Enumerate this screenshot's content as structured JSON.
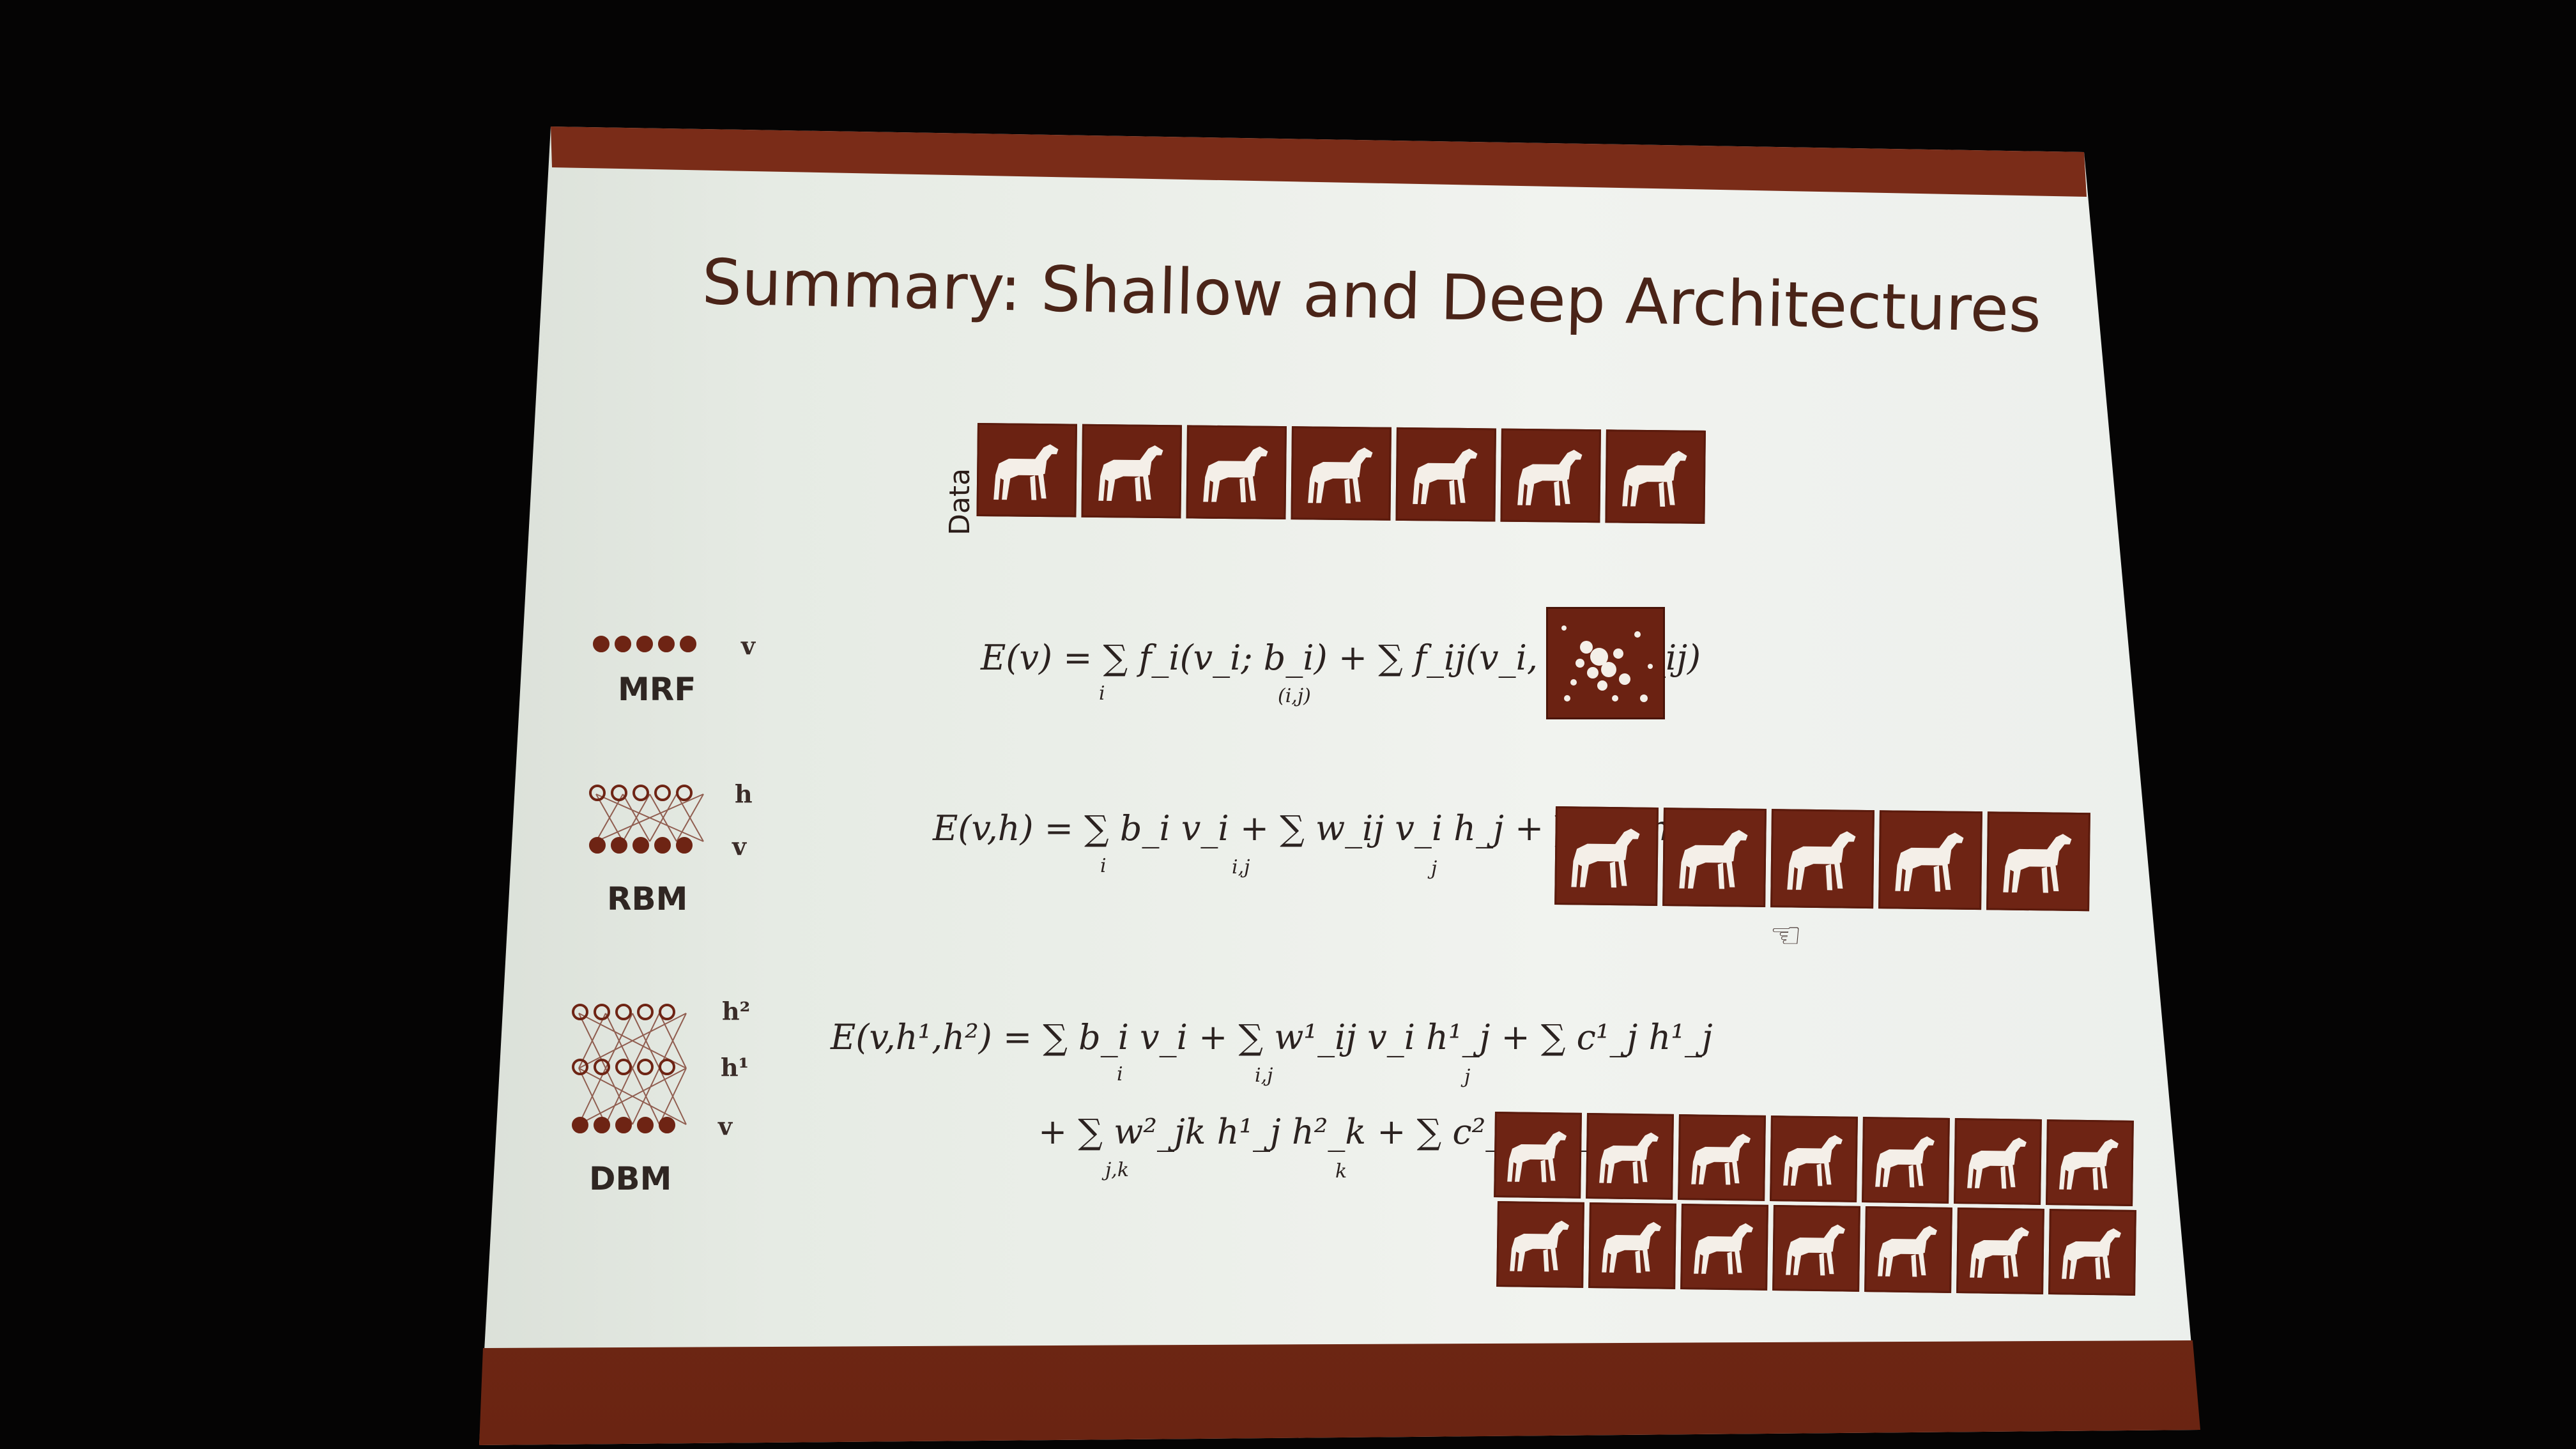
{
  "slide": {
    "title": "Summary: Shallow and Deep Architectures",
    "data_label": "Data",
    "data_tile_count": 7,
    "rbm_sample_count": 5,
    "dbm_sample_rows": 2,
    "dbm_sample_cols": 7,
    "colors": {
      "accent": "#7a2c18",
      "tile": "#6b2212",
      "slide_bg": "#eef1ec",
      "text": "#2b2220"
    }
  },
  "models": {
    "mrf": {
      "label": "MRF",
      "layer_labels": [
        "v"
      ],
      "equation": "E(v) = ∑ f_i(v_i; b_i) + ∑ f_ij(v_i, v_j; w_ij)",
      "sum_indices": [
        "i",
        "(i,j)"
      ]
    },
    "rbm": {
      "label": "RBM",
      "layer_labels": [
        "h",
        "v"
      ],
      "equation": "E(v,h) = ∑ b_i v_i + ∑ w_ij v_i h_j + ∑ c_j h_j",
      "sum_indices": [
        "i",
        "i,j",
        "j"
      ]
    },
    "dbm": {
      "label": "DBM",
      "layer_labels": [
        "h²",
        "h¹",
        "v"
      ],
      "equation_line1": "E(v,h¹,h²) = ∑ b_i v_i + ∑ w¹_ij v_i h¹_j + ∑ c¹_j h¹_j",
      "equation_line2": "+ ∑ w²_jk h¹_j h²_k + ∑ c²_k h²_k.",
      "sum_indices_line1": [
        "i",
        "i,j",
        "j"
      ],
      "sum_indices_line2": [
        "j,k",
        "k"
      ]
    }
  }
}
